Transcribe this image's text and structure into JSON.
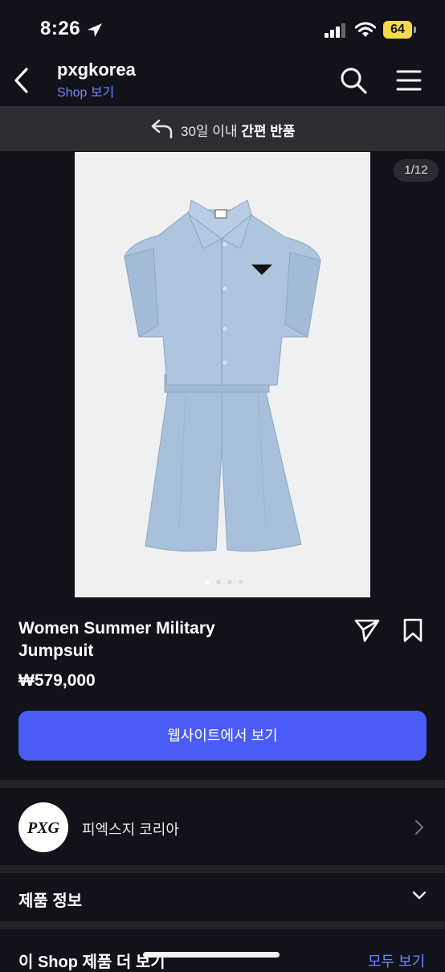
{
  "status_bar": {
    "time": "8:26",
    "battery": "64"
  },
  "header": {
    "title": "pxgkorea",
    "subtitle": "Shop 보기"
  },
  "banner": {
    "text_plain": "30일 이내 ",
    "text_bold": "간편 반품"
  },
  "gallery": {
    "counter": "1/12",
    "dot_count": 4,
    "active_dot": 0
  },
  "product": {
    "name": "Women Summer Military Jumpsuit",
    "price": "₩579,000",
    "cta_label": "웹사이트에서 보기"
  },
  "shop": {
    "name": "피엑스지 코리아",
    "logo_text": "PXG"
  },
  "sections": {
    "product_info": "제품 정보",
    "more_from_shop": "이 Shop 제품 더 보기",
    "see_all": "모두 보기"
  },
  "icons": {
    "back": "back-arrow-icon",
    "search": "search-icon",
    "menu": "hamburger-menu-icon",
    "return": "return-arrow-icon",
    "share": "send-share-icon",
    "bookmark": "bookmark-icon",
    "chevron_right": "chevron-right-icon",
    "chevron_down": "chevron-down-icon"
  },
  "colors": {
    "background": "#12131a",
    "accent": "#4a5cf6",
    "link": "#6e86ff",
    "battery": "#f5d94a",
    "garment": "#a9c0dc"
  }
}
